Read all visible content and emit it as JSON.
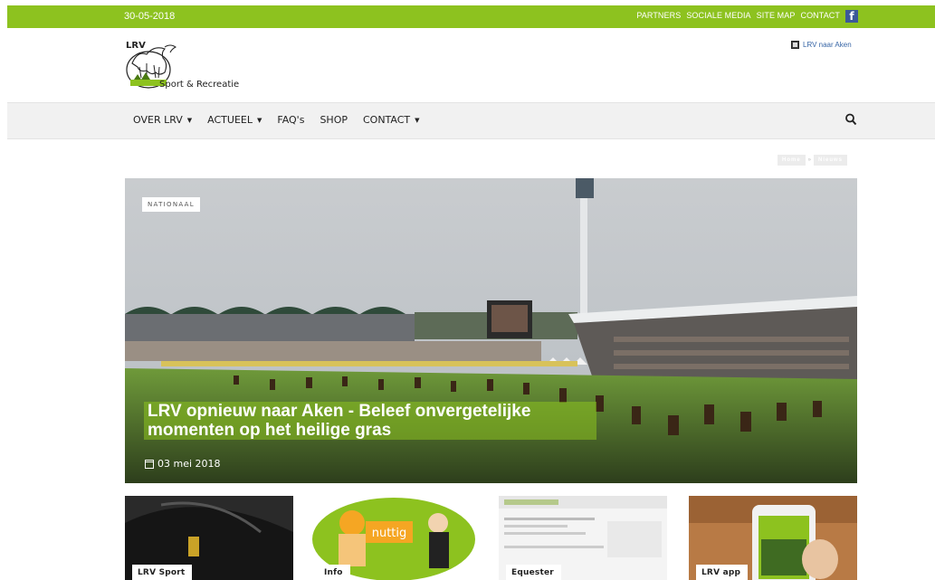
{
  "topbar": {
    "date": "30-05-2018",
    "links": [
      "PARTNERS",
      "SOCIALE MEDIA",
      "SITE MAP",
      "CONTACT"
    ],
    "facebook_icon": "f"
  },
  "logo": {
    "brand": "LRV",
    "subtitle": "Sport & Recreatie"
  },
  "aken_link": "LRV naar Aken",
  "nav": {
    "items": [
      {
        "label": "OVER LRV",
        "dropdown": true
      },
      {
        "label": "ACTUEEL",
        "dropdown": true
      },
      {
        "label": "FAQ's",
        "dropdown": false
      },
      {
        "label": "SHOP",
        "dropdown": false
      },
      {
        "label": "CONTACT",
        "dropdown": true
      }
    ],
    "caret": "▼"
  },
  "breadcrumb": {
    "items": [
      "Home",
      "Nieuws"
    ],
    "separator": "»"
  },
  "hero": {
    "category": "NATIONAAL",
    "title": "LRV opnieuw naar Aken - Beleef onvergetelijke momenten op het heilige gras",
    "date": "03 mei 2018"
  },
  "tiles": [
    {
      "label": "LRV Sport"
    },
    {
      "label": "Info",
      "bubble_text": "nuttig"
    },
    {
      "label": "Equester"
    },
    {
      "label": "LRV app"
    }
  ],
  "colors": {
    "accent": "#8dc21f",
    "nav_bg": "#f1f1f1",
    "facebook": "#3b5998",
    "link": "#3866a6"
  }
}
